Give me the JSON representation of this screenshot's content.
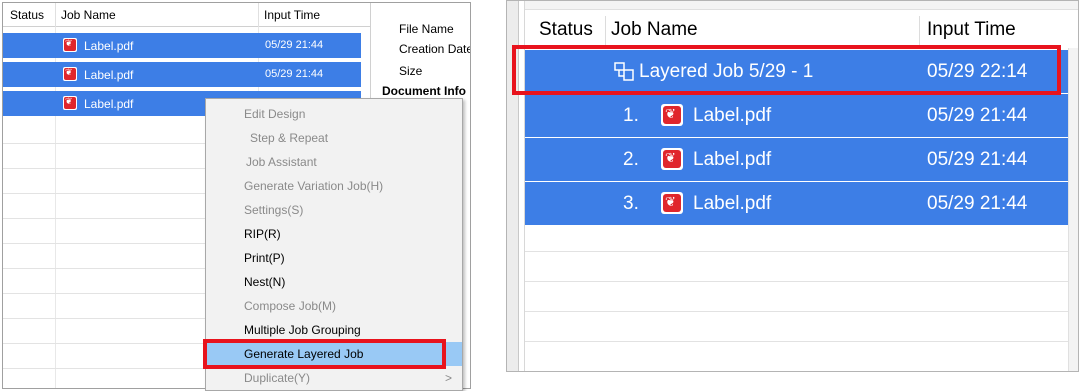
{
  "left_panel": {
    "columns": {
      "status": "Status",
      "job_name": "Job Name",
      "input_time": "Input Time"
    },
    "rows": [
      {
        "name": "Label.pdf",
        "time": "05/29 21:44"
      },
      {
        "name": "Label.pdf",
        "time": "05/29 21:44"
      },
      {
        "name": "Label.pdf",
        "time": ""
      }
    ],
    "properties": {
      "file_name": "File Name",
      "creation_date": "Creation Date",
      "size": "Size",
      "document_info": "Document Info"
    },
    "context_menu": {
      "items": [
        {
          "label": "Edit Design",
          "enabled": false
        },
        {
          "label": "Step & Repeat",
          "enabled": false
        },
        {
          "label": "Job Assistant",
          "enabled": false
        },
        {
          "label": "Generate Variation Job(H)",
          "enabled": false
        },
        {
          "label": "Settings(S)",
          "enabled": false
        },
        {
          "label": "RIP(R)",
          "enabled": true
        },
        {
          "label": "Print(P)",
          "enabled": true
        },
        {
          "label": "Nest(N)",
          "enabled": true
        },
        {
          "label": "Compose Job(M)",
          "enabled": false
        },
        {
          "label": "Multiple Job Grouping",
          "enabled": true
        },
        {
          "label": "Generate Layered Job",
          "enabled": true,
          "highlighted": true
        },
        {
          "label": "Duplicate(Y)",
          "enabled": false,
          "submenu": true
        }
      ],
      "submenu_arrow": ">"
    }
  },
  "right_panel": {
    "columns": {
      "status": "Status",
      "job_name": "Job Name",
      "input_time": "Input Time"
    },
    "layered_job": {
      "name": "Layered Job 5/29 - 1",
      "time": "05/29 22:14",
      "icon": "layered-job-icon"
    },
    "children": [
      {
        "index": "1.",
        "name": "Label.pdf",
        "time": "05/29 21:44",
        "icon": "pdf-icon"
      },
      {
        "index": "2.",
        "name": "Label.pdf",
        "time": "05/29 21:44",
        "icon": "pdf-icon"
      },
      {
        "index": "3.",
        "name": "Label.pdf",
        "time": "05/29 21:44",
        "icon": "pdf-icon"
      }
    ]
  },
  "colors": {
    "selection": "#3d7ee6",
    "menu_highlight": "#99c9f5",
    "callout": "#e8131d",
    "pdf": "#e0262c"
  }
}
